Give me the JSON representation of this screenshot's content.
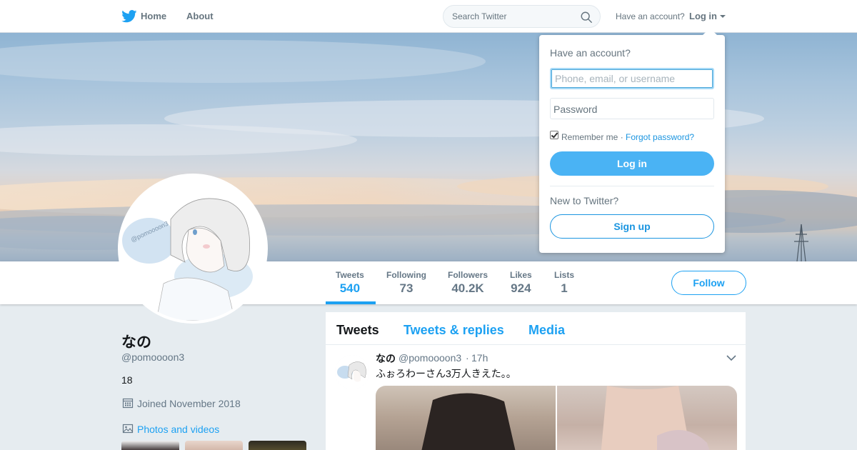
{
  "topnav": {
    "logo_icon": "twitter-bird-icon",
    "home_label": "Home",
    "about_label": "About",
    "search_placeholder": "Search Twitter",
    "search_icon": "search-icon",
    "have_account_label": "Have an account?",
    "login_label": "Log in"
  },
  "profile": {
    "name": "なの",
    "handle": "@pomoooon3",
    "bio": "18",
    "joined": "Joined November 2018",
    "photos_label": "Photos and videos"
  },
  "stats": [
    {
      "label": "Tweets",
      "value": "540"
    },
    {
      "label": "Following",
      "value": "73"
    },
    {
      "label": "Followers",
      "value": "40.2K"
    },
    {
      "label": "Likes",
      "value": "924"
    },
    {
      "label": "Lists",
      "value": "1"
    }
  ],
  "follow_label": "Follow",
  "timeline": {
    "tabs": [
      "Tweets",
      "Tweets & replies",
      "Media"
    ],
    "tweet": {
      "name": "なの",
      "handle": "@pomoooon3",
      "separator": "·",
      "time": "17h",
      "text": "ふぉろわーさん3万人きえた。。"
    }
  },
  "login_dropdown": {
    "title": "Have an account?",
    "username_placeholder": "Phone, email, or username",
    "password_label": "Password",
    "remember_label": "Remember me ·",
    "forgot_label": "Forgot password?",
    "login_button": "Log in",
    "new_label": "New to Twitter?",
    "signup_button": "Sign up"
  },
  "colors": {
    "accent": "#1da1f2",
    "page_bg": "#e6ecf0",
    "login_button_bg": "#4ab3f4"
  }
}
